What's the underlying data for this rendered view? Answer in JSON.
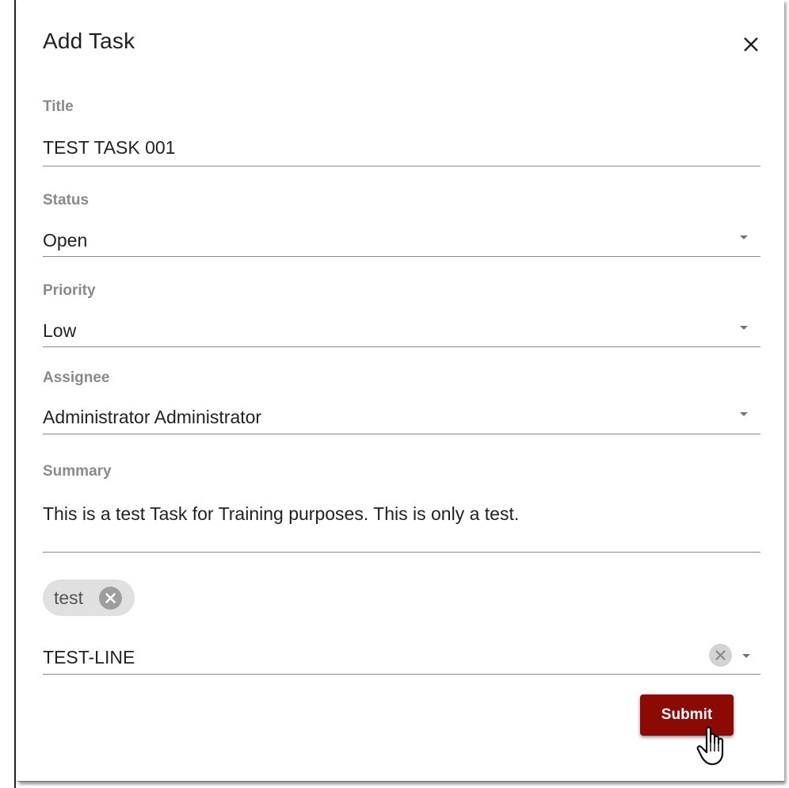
{
  "dialog": {
    "title": "Add Task",
    "close_icon": "close-icon"
  },
  "fields": {
    "title": {
      "label": "Title",
      "value": "TEST TASK 001"
    },
    "status": {
      "label": "Status",
      "value": "Open"
    },
    "priority": {
      "label": "Priority",
      "value": "Low"
    },
    "assignee": {
      "label": "Assignee",
      "value": "Administrator Administrator"
    },
    "summary": {
      "label": "Summary",
      "value": "This is a test Task for Training purposes. This is only a test."
    }
  },
  "tags": {
    "chips": [
      {
        "label": "test"
      }
    ],
    "line_value": "TEST-LINE"
  },
  "actions": {
    "submit_label": "Submit"
  },
  "colors": {
    "primary": "#8b0a03",
    "label": "#8a8a8a",
    "text": "#222222"
  }
}
